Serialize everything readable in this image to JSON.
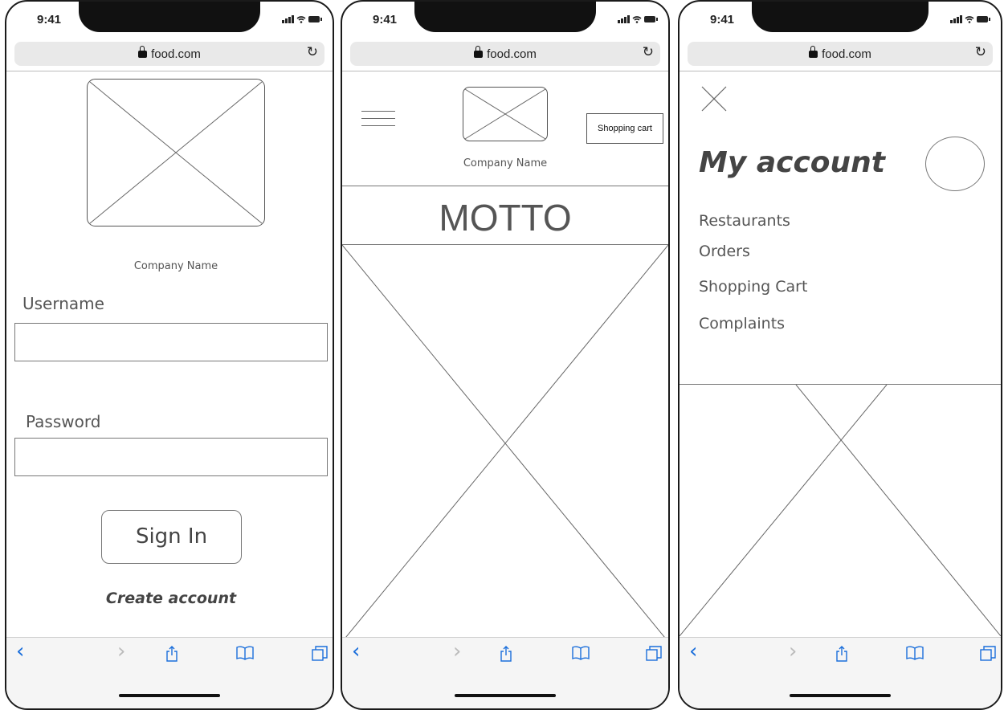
{
  "device": {
    "time": "9:41",
    "url": "food.com"
  },
  "login": {
    "company_name": "Company Name",
    "username_label": "Username",
    "username_value": "",
    "password_label": "Password",
    "password_value": "",
    "signin_label": "Sign In",
    "create_account_label": "Create account"
  },
  "home": {
    "company_name": "Company Name",
    "shopping_cart_label": "Shopping cart",
    "motto": "MOTTO"
  },
  "menu": {
    "title": "My account",
    "items": [
      {
        "label": "Restaurants"
      },
      {
        "label": "Orders"
      },
      {
        "label": "Shopping Cart"
      },
      {
        "label": "Complaints"
      }
    ]
  },
  "toolbar": {
    "icons": [
      "back-icon",
      "forward-icon",
      "share-icon",
      "bookmarks-icon",
      "tabs-icon"
    ]
  },
  "colors": {
    "ios_blue": "#1a6edb",
    "wire_gray": "#777777",
    "text_gray": "#555555"
  }
}
